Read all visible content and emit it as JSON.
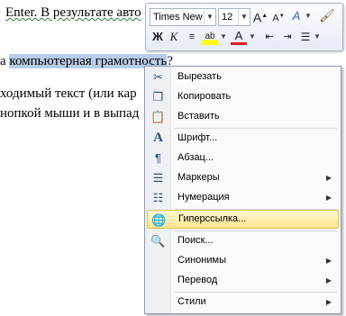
{
  "document": {
    "line1": "Enter. В результате авто",
    "line2_pre": "а ",
    "line2_selected": "компьютерная грамотность",
    "line2_post": "?",
    "line3": "ходимый текст (или кар",
    "line4": "нопкой мыши и в выпад"
  },
  "mini_toolbar": {
    "font_name": "Times New",
    "font_size": "12",
    "buttons": {
      "grow_font": "A",
      "shrink_font": "A",
      "styles": "A",
      "bold": "Ж",
      "italic": "К",
      "font_color": "A"
    }
  },
  "context_menu": {
    "items": [
      {
        "icon": "scissors-icon",
        "label": "Вырезать"
      },
      {
        "icon": "copy-icon",
        "label": "Копировать"
      },
      {
        "icon": "paste-icon",
        "label": "Вставить"
      },
      {
        "icon": "font-icon",
        "label": "Шрифт..."
      },
      {
        "icon": "paragraph-icon",
        "label": "Абзац..."
      },
      {
        "icon": "bullets-icon",
        "label": "Маркеры"
      },
      {
        "icon": "numbering-icon",
        "label": "Нумерация"
      },
      {
        "icon": "hyperlink-icon",
        "label": "Гиперссылка..."
      },
      {
        "icon": "search-icon",
        "label": "Поиск..."
      },
      {
        "icon": "",
        "label": "Синонимы"
      },
      {
        "icon": "",
        "label": "Перевод"
      },
      {
        "icon": "",
        "label": "Стили"
      }
    ],
    "highlighted": "Гиперссылка..."
  }
}
